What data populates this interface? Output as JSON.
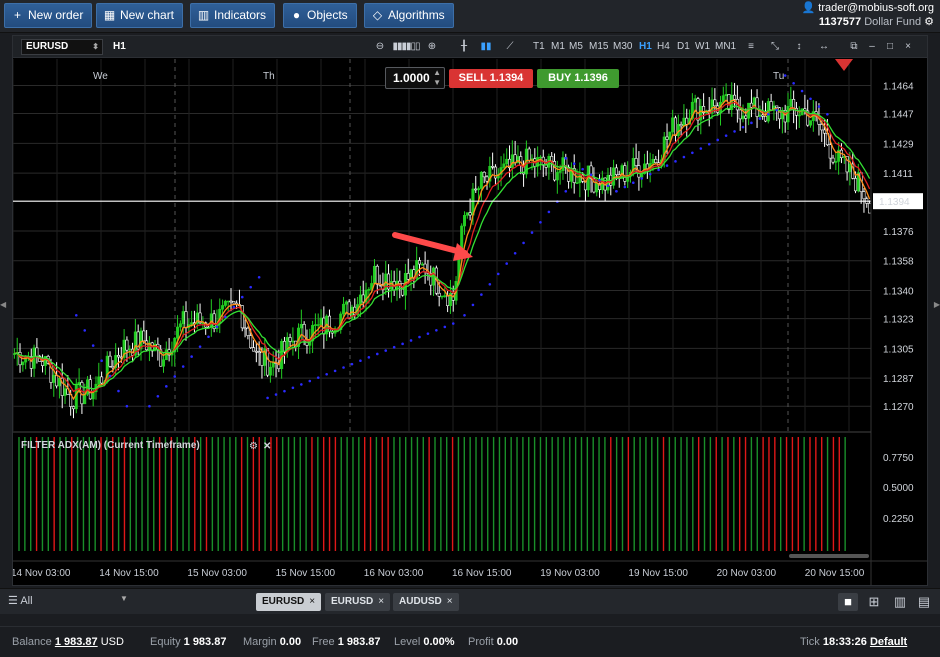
{
  "toolbar": {
    "new_order": "New order",
    "new_chart": "New chart",
    "indicators": "Indicators",
    "objects": "Objects",
    "algorithms": "Algorithms"
  },
  "account": {
    "email": "trader@mobius-soft.org",
    "number": "1137577",
    "fund": "Dollar Fund"
  },
  "chart_toolbar": {
    "symbol": "EURUSD",
    "timeframe": "H1",
    "timeframes": [
      "T1",
      "M1",
      "M5",
      "M15",
      "M30",
      "H1",
      "H4",
      "D1",
      "W1",
      "MN1"
    ],
    "active_timeframe": "H1"
  },
  "order_panel": {
    "lots": "1.0000",
    "sell_label": "SELL",
    "sell_price": "1.1394",
    "buy_label": "BUY",
    "buy_price": "1.1396"
  },
  "indicator_label": "FILTER ADX(AM) (Current Timeframe)",
  "colors": {
    "bull": "#22cc22",
    "bear": "#ffffff",
    "sell": "#d93433",
    "buy": "#3f9a2f",
    "ma_fast": "#ff8c1a",
    "ma_slow": "#e02020",
    "ma_green": "#33e033",
    "sar": "#2a2aff",
    "accent": "#2f5f98"
  },
  "chart_data": {
    "type": "candlestick",
    "symbol": "EURUSD",
    "timeframe": "H1",
    "current_price": "1.1394",
    "y_ticks": [
      "1.1464",
      "1.1447",
      "1.1429",
      "1.1411",
      "1.1376",
      "1.1358",
      "1.1340",
      "1.1323",
      "1.1305",
      "1.1287",
      "1.1270"
    ],
    "ylim": [
      1.1255,
      1.148
    ],
    "day_markers": [
      "We",
      "Th",
      "Tu"
    ],
    "x_ticks": [
      "14 Nov 03:00",
      "14 Nov 15:00",
      "15 Nov 03:00",
      "15 Nov 15:00",
      "16 Nov 03:00",
      "16 Nov 15:00",
      "19 Nov 03:00",
      "19 Nov 15:00",
      "20 Nov 03:00",
      "20 Nov 15:00"
    ],
    "close_path": [
      [
        0,
        1.1302
      ],
      [
        10,
        1.1298
      ],
      [
        20,
        1.1275
      ],
      [
        28,
        1.128
      ],
      [
        38,
        1.1305
      ],
      [
        46,
        1.131
      ],
      [
        52,
        1.13
      ],
      [
        60,
        1.132
      ],
      [
        70,
        1.1322
      ],
      [
        80,
        1.133
      ],
      [
        86,
        1.13
      ],
      [
        92,
        1.1295
      ],
      [
        100,
        1.1312
      ],
      [
        110,
        1.1318
      ],
      [
        120,
        1.133
      ],
      [
        128,
        1.135
      ],
      [
        138,
        1.1345
      ],
      [
        146,
        1.1355
      ],
      [
        150,
        1.1345
      ],
      [
        156,
        1.1335
      ],
      [
        160,
        1.1385
      ],
      [
        166,
        1.1405
      ],
      [
        174,
        1.1412
      ],
      [
        182,
        1.1418
      ],
      [
        190,
        1.1415
      ],
      [
        200,
        1.141
      ],
      [
        210,
        1.1405
      ],
      [
        218,
        1.1412
      ],
      [
        228,
        1.142
      ],
      [
        234,
        1.1438
      ],
      [
        240,
        1.145
      ],
      [
        250,
        1.1452
      ],
      [
        260,
        1.145
      ],
      [
        270,
        1.1447
      ],
      [
        280,
        1.1449
      ],
      [
        286,
        1.144
      ],
      [
        292,
        1.142
      ],
      [
        300,
        1.1405
      ],
      [
        304,
        1.1394
      ]
    ],
    "sar_segments": [
      {
        "from": [
          22,
          1.1325
        ],
        "to": [
          40,
          1.127
        ]
      },
      {
        "from": [
          48,
          1.127
        ],
        "to": [
          88,
          1.135
        ]
      },
      {
        "from": [
          90,
          1.1275
        ],
        "to": [
          156,
          1.132
        ]
      },
      {
        "from": [
          160,
          1.1325
        ],
        "to": [
          196,
          1.14
        ]
      },
      {
        "from": [
          196,
          1.142
        ],
        "to": [
          214,
          1.14
        ]
      },
      {
        "from": [
          214,
          1.14
        ],
        "to": [
          272,
          1.145
        ]
      },
      {
        "from": [
          274,
          1.147
        ],
        "to": [
          290,
          1.1445
        ]
      }
    ],
    "adx_y_ticks": [
      "0.7750",
      "0.5000",
      "0.2250"
    ],
    "adx_bars": "GGGRGGRGGRGGGGRGRGRGGGGGRGRGGGRGRGGGGGRGRRGRRGGGGGRGRRRGGGGRRGRRGGGGGGRGGGRGGGGGGGGGGGGGGGGGGGGGGGGGGRGGRGGGGGRGGGGGRGGRGRGRRGGRRRGRRRGRRRGRRG"
  },
  "symbol_tabs": [
    "EURUSD",
    "EURUSD",
    "AUDUSD"
  ],
  "filter_label": "All",
  "status": {
    "balance_label": "Balance",
    "balance": "1 983.87",
    "currency": "USD",
    "equity_label": "Equity",
    "equity": "1 983.87",
    "margin_label": "Margin",
    "margin": "0.00",
    "free_label": "Free",
    "free": "1 983.87",
    "level_label": "Level",
    "level": "0.00%",
    "profit_label": "Profit",
    "profit": "0.00",
    "tick_label": "Tick",
    "time": "18:33:26",
    "server": "Default"
  }
}
